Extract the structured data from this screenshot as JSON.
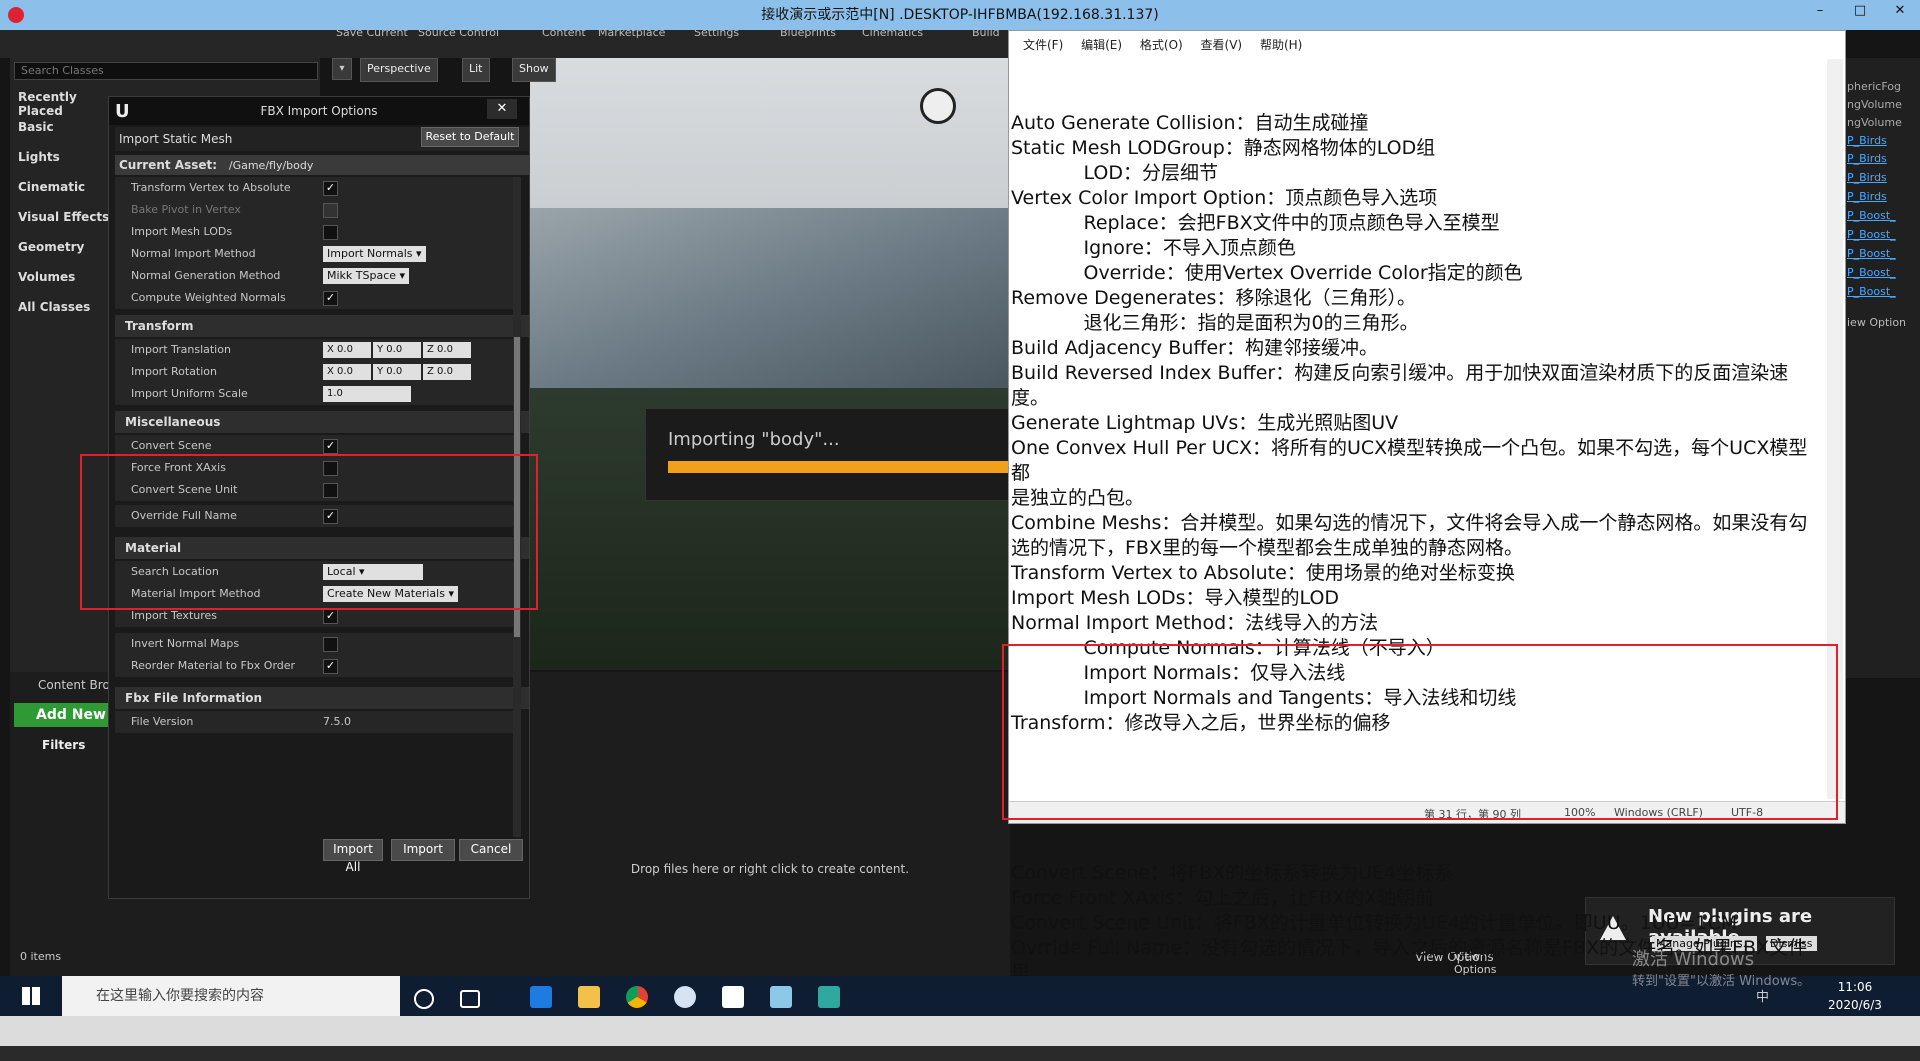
{
  "rdp": {
    "title": "接收演示或示范中[N] .DESKTOP-IHFBMBA(192.168.31.137)",
    "min": "–",
    "max": "□",
    "close": "✕"
  },
  "ue": {
    "toolbar": [
      "Save Current",
      "Source Control",
      "Content",
      "Marketplace",
      "Settings",
      "Blueprints",
      "Cinematics",
      "Build"
    ],
    "search_classes_placeholder": "Search Classes",
    "modes": [
      "Recently Placed",
      "Basic",
      "Lights",
      "Cinematic",
      "Visual Effects",
      "Geometry",
      "Volumes",
      "All Classes"
    ],
    "viewport": {
      "perspective": "Perspective",
      "lit": "Lit",
      "show": "Show",
      "importing": "Importing \"body\"..."
    },
    "content_browser": {
      "tab": "Content Browser",
      "add_new": "Add New",
      "filters": "Filters",
      "drop_hint": "Drop files here or right click to create content.",
      "items": "0 items",
      "view_options": "View Options"
    },
    "right_panel": [
      "phericFog",
      "ngVolume",
      "ngVolume",
      "P_Birds",
      "P_Birds",
      "P_Birds",
      "P_Birds",
      "P_Boost_",
      "P_Boost_",
      "P_Boost_",
      "P_Boost_",
      "P_Boost_",
      "iew Option"
    ],
    "plugins": {
      "title": "New plugins are available",
      "manage": "Manage Plugins...",
      "dismiss": "Dismiss"
    }
  },
  "fbx": {
    "title": "FBX Import Options",
    "import_static_mesh": "Import Static Mesh",
    "reset": "Reset to Default",
    "current_asset_label": "Current Asset:",
    "current_asset": "/Game/fly/body",
    "rows_top": [
      {
        "label": "Transform Vertex to Absolute",
        "checked": true
      },
      {
        "label": "Bake Pivot in Vertex",
        "checked": false,
        "disabled": true
      },
      {
        "label": "Import Mesh LODs",
        "checked": false
      },
      {
        "label": "Normal Import Method",
        "dropdown": "Import Normals"
      },
      {
        "label": "Normal Generation Method",
        "dropdown": "Mikk TSpace"
      },
      {
        "label": "Compute Weighted Normals",
        "checked": true
      }
    ],
    "transform": {
      "title": "Transform",
      "translation": {
        "label": "Import Translation",
        "x": "0.0",
        "y": "0.0",
        "z": "0.0"
      },
      "rotation": {
        "label": "Import Rotation",
        "x": "0.0",
        "y": "0.0",
        "z": "0.0"
      },
      "uniform_scale": {
        "label": "Import Uniform Scale",
        "value": "1.0"
      }
    },
    "misc": {
      "title": "Miscellaneous",
      "rows": [
        {
          "label": "Convert Scene",
          "checked": true
        },
        {
          "label": "Force Front XAxis",
          "checked": false
        },
        {
          "label": "Convert Scene Unit",
          "checked": false
        },
        {
          "label": "Override Full Name",
          "checked": true
        }
      ]
    },
    "material": {
      "title": "Material",
      "search_location": {
        "label": "Search Location",
        "value": "Local"
      },
      "import_method": {
        "label": "Material Import Method",
        "value": "Create New Materials"
      },
      "import_textures": {
        "label": "Import Textures",
        "checked": true
      },
      "invert_normal_maps": {
        "label": "Invert Normal Maps",
        "checked": false
      },
      "reorder": {
        "label": "Reorder Material to Fbx Order",
        "checked": true
      }
    },
    "file_info": {
      "title": "Fbx File Information",
      "version_label": "File Version",
      "version": "7.5.0"
    },
    "buttons": {
      "import_all": "Import All",
      "import": "Import",
      "cancel": "Cancel"
    }
  },
  "notepad": {
    "menu": [
      "文件(F)",
      "编辑(E)",
      "格式(O)",
      "查看(V)",
      "帮助(H)"
    ],
    "text_main": "Auto Generate Collision：自动生成碰撞\nStatic Mesh LODGroup：静态网格物体的LOD组\n            LOD：分层细节\nVertex Color Import Option：顶点颜色导入选项\n            Replace：会把FBX文件中的顶点颜色导入至模型\n            Ignore：不导入顶点颜色\n            Override：使用Vertex Override Color指定的颜色\nRemove Degenerates：移除退化（三角形）。\n            退化三角形：指的是面积为0的三角形。\nBuild Adjacency Buffer：构建邻接缓冲。\nBuild Reversed Index Buffer：构建反向索引缓冲。用于加快双面渲染材质下的反面渲染速度。\nGenerate Lightmap UVs：生成光照贴图UV\nOne Convex Hull Per UCX：将所有的UCX模型转换成一个凸包。如果不勾选，每个UCX模型都\n是独立的凸包。\nCombine Meshs：合并模型。如果勾选的情况下，文件将会导入成一个静态网格。如果没有勾\n选的情况下，FBX里的每一个模型都会生成单独的静态网格。\nTransform Vertex to Absolute：使用场景的绝对坐标变换\nImport Mesh LODs：导入模型的LOD\nNormal Import Method：法线导入的方法\n            Compute Normals：计算法线（不导入）\n            Import Normals：仅导入法线\n            Import Normals and Tangents：导入法线和切线\nTransform：修改导入之后，世界坐标的偏移",
    "text_highlight": "Convert Scene：将FBX的坐标系转换为UE4坐标系\nForce Front XAxis：勾上之后，让FBX的X轴朝前\nConvert Scene Unit：将FBX的计量单位转换为UE4的计量单位。即UU。1UU=1CM\nOvrride Full Name：没有勾选的情况下，导入之后的资源名称是FBX的文件名。如果FBX文件里\n只有一个模型的情况下，勾选此选项，导入之后的资源名称则会使用模型的名称。",
    "status": {
      "pos": "第 31 行，第 90 列",
      "zoom": "100%",
      "eol": "Windows (CRLF)",
      "enc": "UTF-8"
    }
  },
  "taskbar": {
    "search_placeholder": "在这里输入你要搜索的内容",
    "time": "11:06",
    "date": "2020/6/3",
    "ime": "中",
    "watermark1": "激活 Windows",
    "watermark2": "转到\"设置\"以激活 Windows。"
  }
}
